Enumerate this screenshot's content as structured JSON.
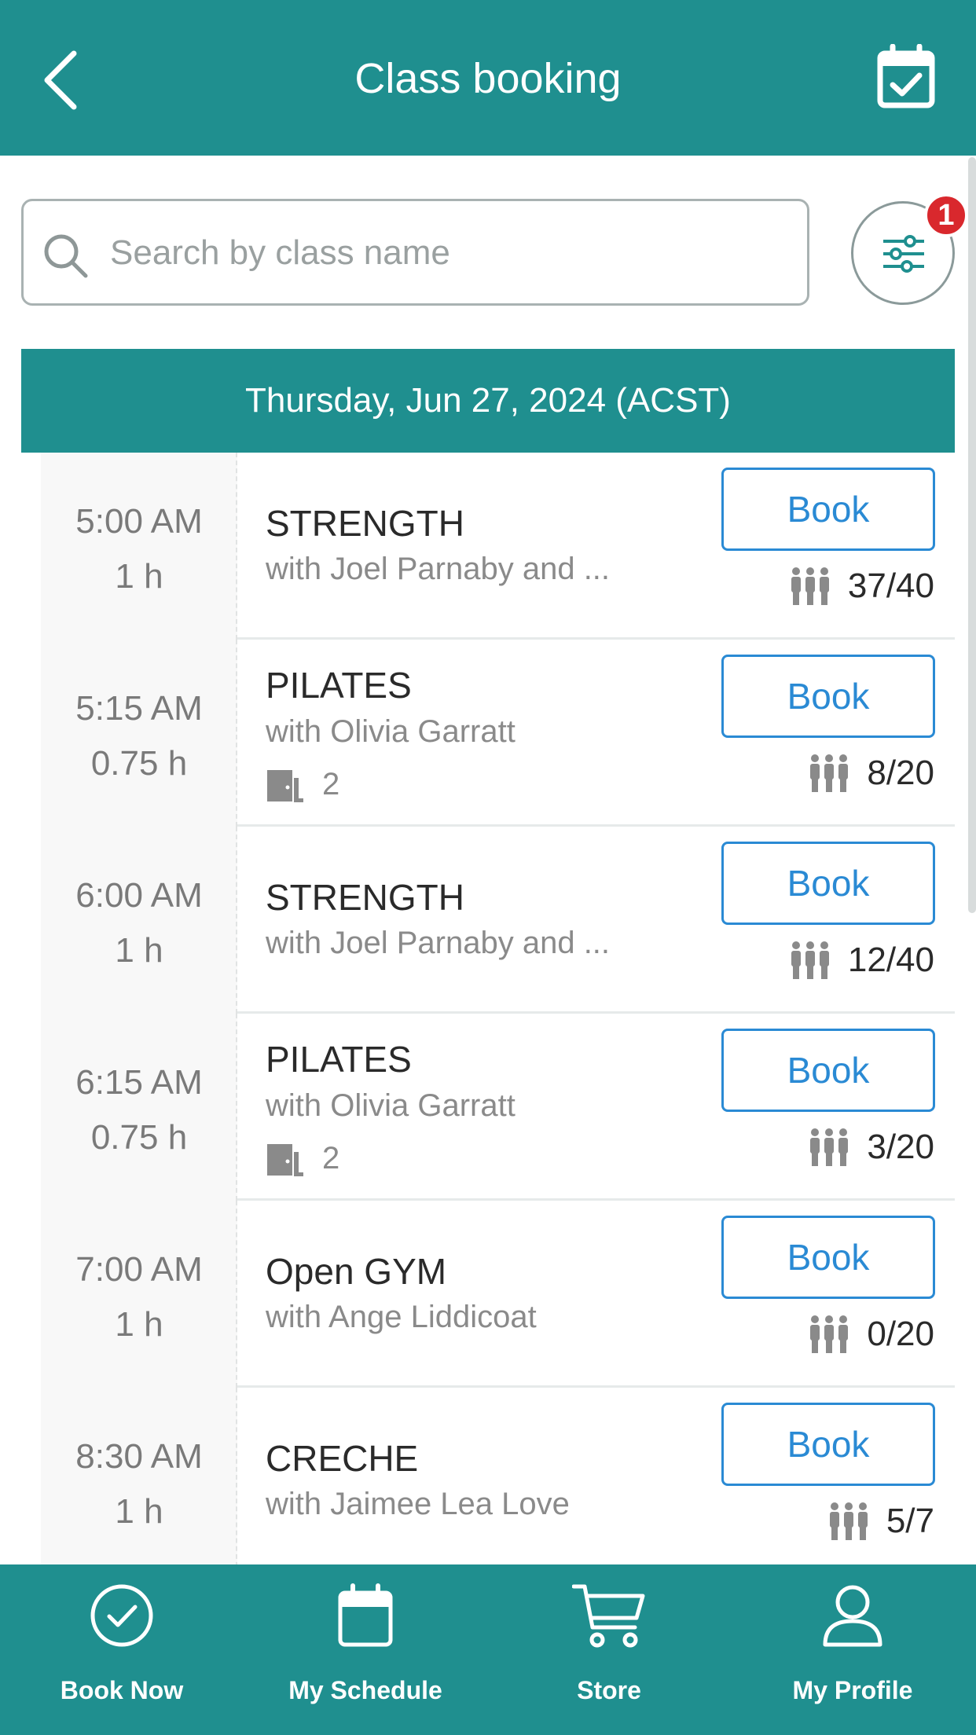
{
  "header": {
    "title": "Class booking",
    "back_icon": "chevron-left-icon",
    "calendar_icon": "calendar-check-icon"
  },
  "search": {
    "placeholder": "Search by class name"
  },
  "filter": {
    "badge": "1"
  },
  "date_header": "Thursday, Jun 27, 2024 (ACST)",
  "classes": [
    {
      "time": "5:00  AM",
      "duration": "1 h",
      "name": "STRENGTH",
      "instructor": "with Joel Parnaby and ...",
      "room": null,
      "book_label": "Book",
      "capacity": "37/40"
    },
    {
      "time": "5:15  AM",
      "duration": "0.75 h",
      "name": "PILATES",
      "instructor": "with Olivia Garratt",
      "room": "2",
      "book_label": "Book",
      "capacity": "8/20"
    },
    {
      "time": "6:00  AM",
      "duration": "1 h",
      "name": "STRENGTH",
      "instructor": "with Joel Parnaby and ...",
      "room": null,
      "book_label": "Book",
      "capacity": "12/40"
    },
    {
      "time": "6:15  AM",
      "duration": "0.75 h",
      "name": "PILATES",
      "instructor": "with Olivia Garratt",
      "room": "2",
      "book_label": "Book",
      "capacity": "3/20"
    },
    {
      "time": "7:00  AM",
      "duration": "1 h",
      "name": "Open GYM",
      "instructor": "with Ange Liddicoat",
      "room": null,
      "book_label": "Book",
      "capacity": "0/20"
    },
    {
      "time": "8:30  AM",
      "duration": "1 h",
      "name": "CRECHE",
      "instructor": "with Jaimee Lea Love",
      "room": null,
      "book_label": "Book",
      "capacity": "5/7"
    }
  ],
  "tabs": [
    {
      "label": "Book Now",
      "icon": "check-circle-icon"
    },
    {
      "label": "My Schedule",
      "icon": "calendar-icon"
    },
    {
      "label": "Store",
      "icon": "cart-icon"
    },
    {
      "label": "My Profile",
      "icon": "profile-icon"
    }
  ],
  "colors": {
    "primary": "#1f8f8f",
    "accent_blue": "#2a8ad4",
    "badge_red": "#d9282d"
  }
}
